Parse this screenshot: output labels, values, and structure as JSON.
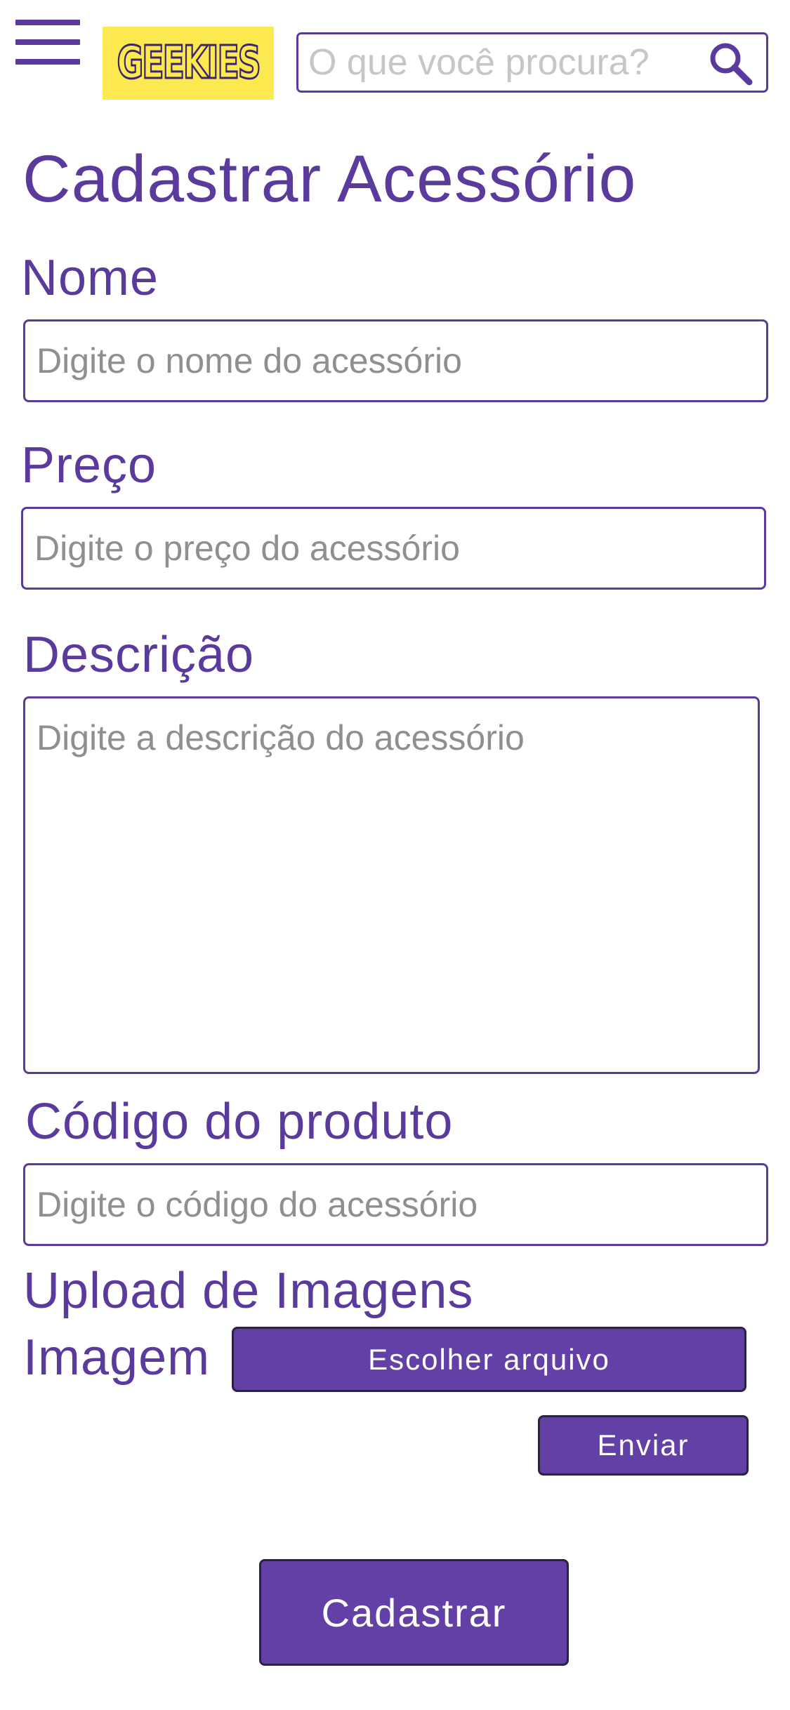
{
  "header": {
    "logo_text": "GEEKIES",
    "search_placeholder": "O que você procura?"
  },
  "page_title": "Cadastrar Acessório",
  "form": {
    "nome": {
      "label": "Nome",
      "placeholder": "Digite o nome do acessório"
    },
    "preco": {
      "label": "Preço",
      "placeholder": "Digite o preço do acessório"
    },
    "descricao": {
      "label": "Descrição",
      "placeholder": "Digite a descrição do acessório"
    },
    "codigo": {
      "label": "Código do produto",
      "placeholder": "Digite o código do acessório"
    },
    "upload": {
      "section_label": "Upload de Imagens",
      "image_label": "Imagem",
      "choose_file_label": "Escolher arquivo",
      "send_label": "Enviar"
    },
    "submit_label": "Cadastrar"
  },
  "colors": {
    "primary": "#5b3a9e",
    "button": "#6340a6",
    "logo_background": "#fce94f"
  }
}
